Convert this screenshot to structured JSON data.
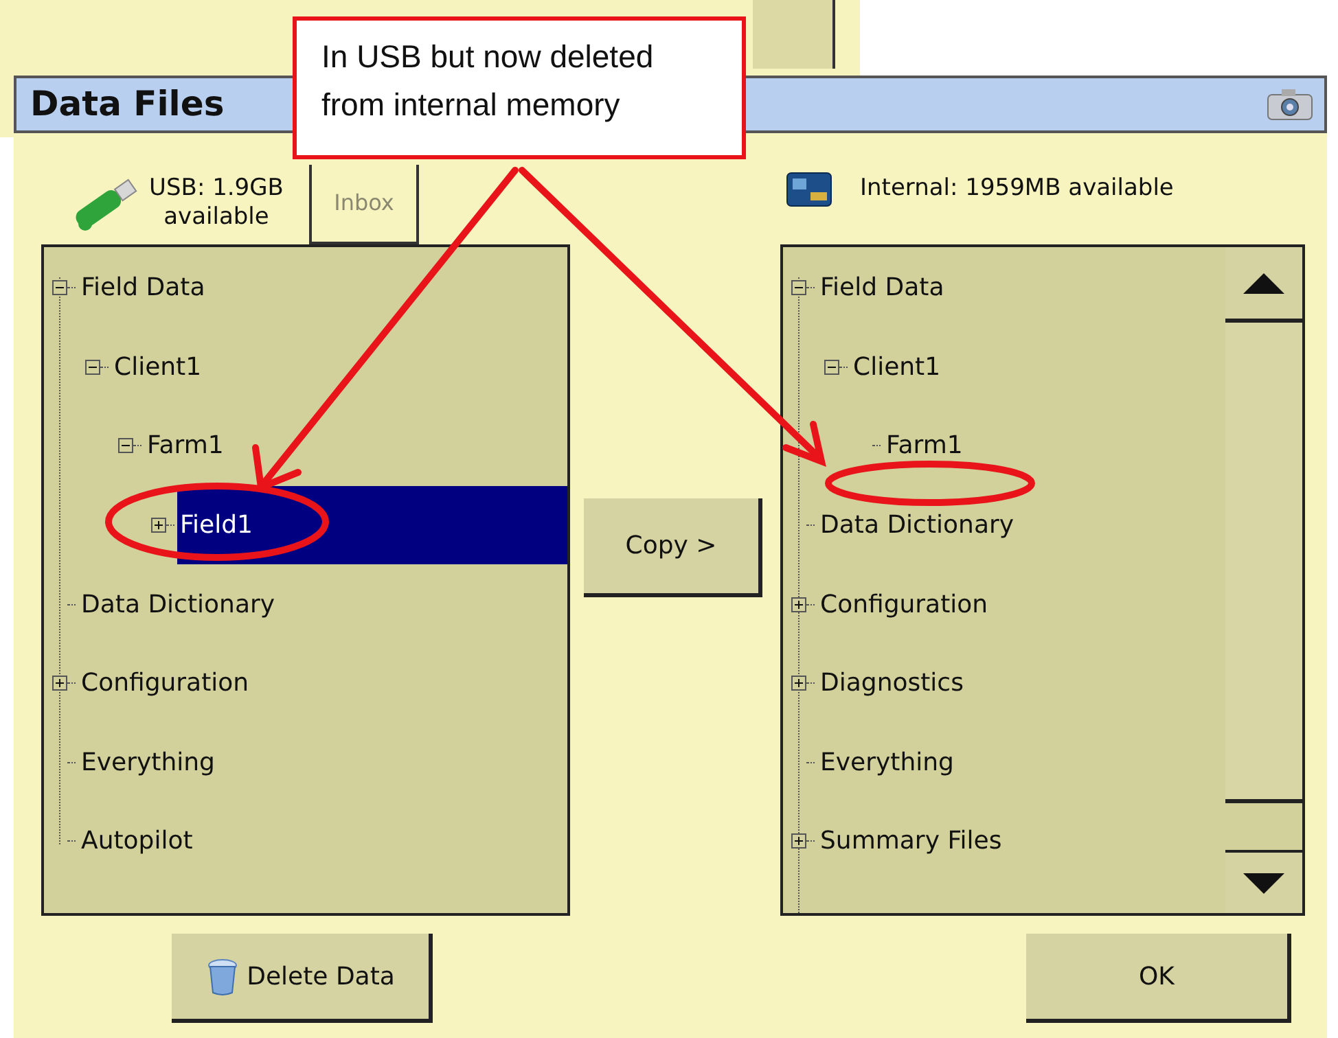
{
  "window": {
    "title": "Data Files"
  },
  "usb_panel": {
    "tabs": [
      {
        "label": "USB: 1.9GB available",
        "kind": "usb",
        "selected": true
      },
      {
        "label": "Inbox",
        "kind": "plain",
        "selected": false
      }
    ],
    "tree": [
      {
        "label": "Field Data",
        "kind": "folder",
        "expanded": true,
        "selected": false,
        "children": [
          {
            "label": "Client1",
            "kind": "folder",
            "expanded": true,
            "selected": false,
            "children": [
              {
                "label": "Farm1",
                "kind": "folder",
                "expanded": true,
                "selected": false,
                "children": [
                  {
                    "label": "Field1",
                    "kind": "folder",
                    "expanded": false,
                    "selected": true
                  }
                ]
              }
            ]
          }
        ]
      },
      {
        "label": "Data Dictionary",
        "kind": "leaf",
        "selected": false
      },
      {
        "label": "Configuration",
        "kind": "folder",
        "expanded": false,
        "selected": false
      },
      {
        "label": "Everything",
        "kind": "leaf",
        "selected": false
      },
      {
        "label": "Autopilot",
        "kind": "leaf",
        "selected": false
      }
    ]
  },
  "copy_button": {
    "label": "Copy >"
  },
  "internal_panel": {
    "storage_label": "Internal: 1959MB available",
    "tree": [
      {
        "label": "Field Data",
        "kind": "folder",
        "expanded": true,
        "selected": false,
        "children": [
          {
            "label": "Client1",
            "kind": "folder",
            "expanded": true,
            "selected": false,
            "children": [
              {
                "label": "Farm1",
                "kind": "leaf",
                "selected": false
              }
            ]
          }
        ]
      },
      {
        "label": "Data Dictionary",
        "kind": "leaf",
        "selected": false
      },
      {
        "label": "Configuration",
        "kind": "folder",
        "expanded": false,
        "selected": false
      },
      {
        "label": "Diagnostics",
        "kind": "folder",
        "expanded": false,
        "selected": false
      },
      {
        "label": "Everything",
        "kind": "leaf",
        "selected": false
      },
      {
        "label": "Summary Files",
        "kind": "folder",
        "expanded": false,
        "selected": false
      }
    ]
  },
  "buttons": [
    {
      "label": "Delete Data",
      "kind": "delete"
    },
    {
      "label": "OK",
      "kind": "ok"
    }
  ],
  "annotation": {
    "text": "In USB but now deleted from internal memory"
  }
}
